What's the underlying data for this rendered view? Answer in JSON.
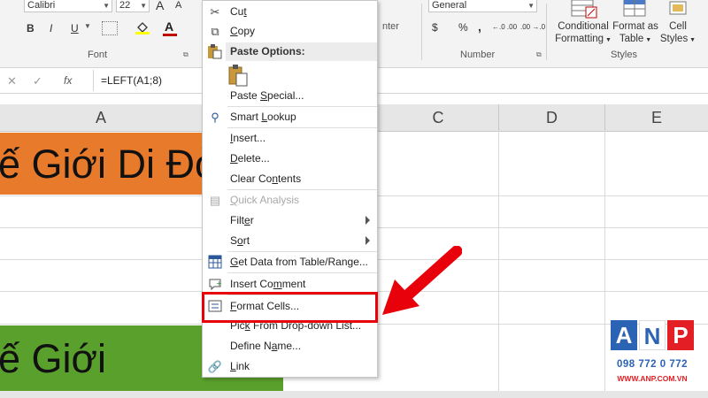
{
  "ribbon": {
    "font_name": "Calibri",
    "font_size": "22",
    "grow_font": "A",
    "shrink_font": "A",
    "bold": "B",
    "italic": "I",
    "underline": "U",
    "font_color_letter": "A",
    "font_group_label": "Font",
    "number_format": "General",
    "currency": "$",
    "percent": "%",
    "comma": ",",
    "inc_decimal": "←.0 .00",
    "dec_decimal": ".00 →.0",
    "number_group_label": "Number",
    "align_fragment": "nter",
    "conditional_formatting_1": "Conditional",
    "conditional_formatting_2": "Formatting",
    "format_as_table_1": "Format as",
    "format_as_table_2": "Table",
    "cell_styles_1": "Cell",
    "cell_styles_2": "Styles",
    "styles_group_label": "Styles",
    "accent_red": "#c00000",
    "fill_yellow": "#ffff00"
  },
  "formula_bar": {
    "cancel": "✕",
    "enter": "✓",
    "fx": "fx",
    "formula": "=LEFT(A1;8)"
  },
  "grid": {
    "columns": [
      "A",
      "C",
      "D",
      "E"
    ],
    "cell_a1_text": "ế Giới Di Đỏ",
    "cell_a1_fill": "#e87b2b",
    "cell_a_lower_text": "ế Giới",
    "cell_a_lower_fill": "#5aa02c"
  },
  "menu": {
    "cut": {
      "pre": "Cu",
      "key": "t",
      "post": ""
    },
    "copy": {
      "pre": "",
      "key": "C",
      "post": "opy"
    },
    "paste_options": "Paste Options:",
    "paste_special": {
      "pre": "Paste ",
      "key": "S",
      "post": "pecial..."
    },
    "smart_lookup": {
      "pre": "Smart ",
      "key": "L",
      "post": "ookup"
    },
    "insert": {
      "pre": "",
      "key": "I",
      "post": "nsert..."
    },
    "delete": {
      "pre": "",
      "key": "D",
      "post": "elete..."
    },
    "clear_contents": {
      "pre": "Clear Co",
      "key": "n",
      "post": "tents"
    },
    "quick_analysis": {
      "pre": "",
      "key": "Q",
      "post": "uick Analysis"
    },
    "filter": {
      "pre": "Filt",
      "key": "e",
      "post": "r"
    },
    "sort": {
      "pre": "S",
      "key": "o",
      "post": "rt"
    },
    "get_data": {
      "pre": "",
      "key": "G",
      "post": "et Data from Table/Range..."
    },
    "insert_comment": {
      "pre": "Insert Co",
      "key": "m",
      "post": "ment"
    },
    "format_cells": {
      "pre": "",
      "key": "F",
      "post": "ormat Cells..."
    },
    "pick_from_list": {
      "pre": "Pic",
      "key": "k",
      "post": " From Drop-down List..."
    },
    "define_name": {
      "pre": "Define N",
      "key": "a",
      "post": "me..."
    },
    "link": {
      "pre": "",
      "key": "L",
      "post": "ink"
    }
  },
  "annotation": {
    "highlight_color": "#e8000b",
    "arrow_color": "#e8000b"
  },
  "watermark": {
    "letters": [
      "A",
      "N",
      "P"
    ],
    "phone": "098 772 0 772",
    "website": "WWW.ANP.COM.VN"
  }
}
